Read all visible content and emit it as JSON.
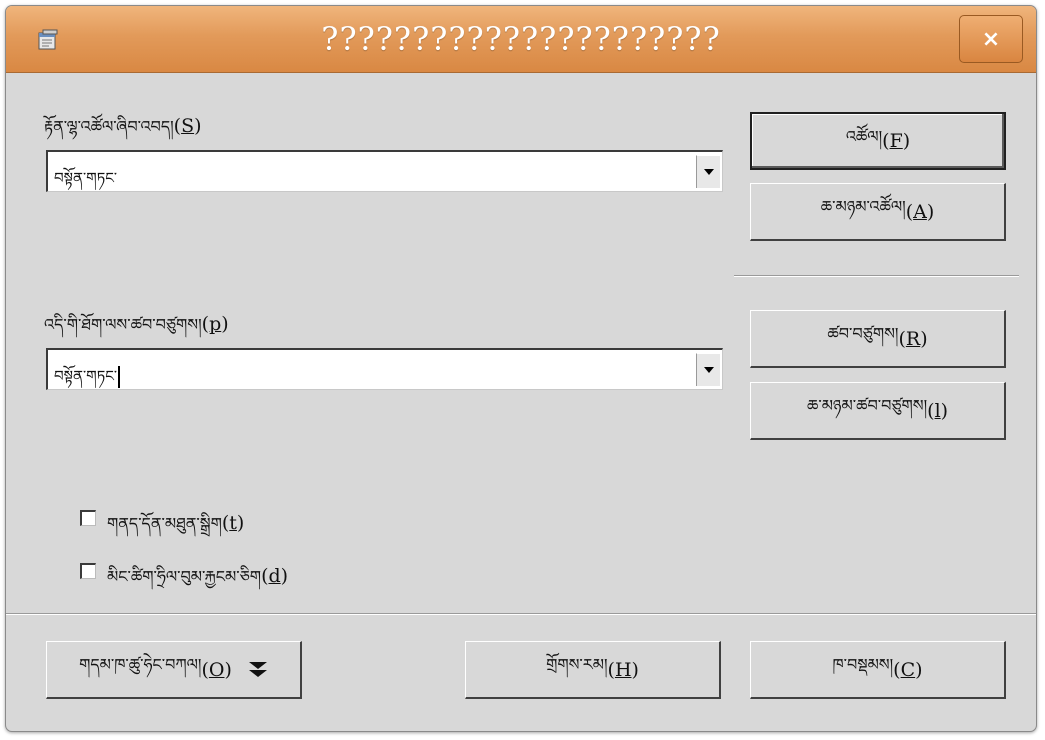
{
  "window": {
    "title": "??????????????????????",
    "close_label": "×"
  },
  "search": {
    "label_text": "རྟོན་ལྷ་འཚོལ་ཞིབ་འབད།",
    "label_paren_open": "(",
    "label_mnemonic": "S",
    "label_paren_close": ")",
    "value": "བསྟོན་གཏང་"
  },
  "replace": {
    "label_text": "འདི་གི་ཐོག་ལས་ཚབ་བཙུགས།",
    "label_paren_open": "(",
    "label_mnemonic": "p",
    "label_paren_close": ")",
    "value": "བསྟོན་གཏང་"
  },
  "buttons": {
    "find": {
      "text": "འཚོལ།",
      "mnemonic": "F"
    },
    "find_all": {
      "text": "ཆ་མཉམ་འཚོལ།",
      "mnemonic": "A"
    },
    "replace": {
      "text": "ཚབ་བཙུགས།",
      "mnemonic": "R"
    },
    "replace_all": {
      "text": "ཆ་མཉམ་ཚབ་བཙུགས།",
      "mnemonic": "l"
    },
    "more_options": {
      "text": "གདམ་ཁ་ཚུ་ཧེང་བཀལ།",
      "mnemonic": "O"
    },
    "help": {
      "text": "གྲོགས་རམ།",
      "mnemonic": "H"
    },
    "close": {
      "text": "ཁ་བསྡམས།",
      "mnemonic": "C"
    }
  },
  "options": {
    "match_case": {
      "text": "གནད་དོན་མཐུན་སྒྲིག",
      "mnemonic": "t",
      "checked": false
    },
    "whole_words": {
      "text": "མིང་ཚིག་ཧྲིལ་བུམ་རྐྱངམ་ཅིག",
      "mnemonic": "d",
      "checked": false
    }
  },
  "colors": {
    "titlebar": "#e29a5a",
    "dialog_bg": "#d8d8d8"
  },
  "icons": {
    "app": "app-window-icon",
    "close": "close-icon",
    "dropdown": "dropdown-arrow-icon",
    "expand": "double-chevron-down-icon"
  }
}
